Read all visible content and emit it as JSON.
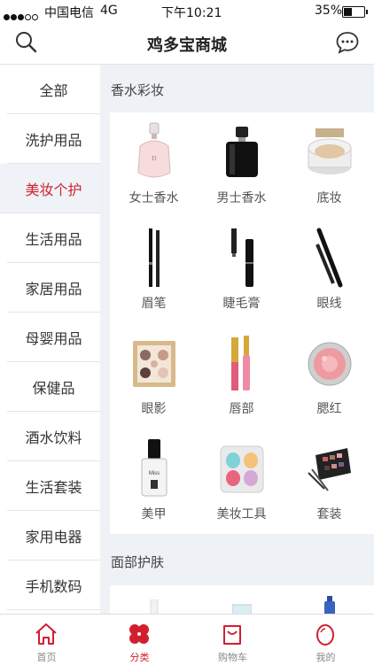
{
  "status_bar": {
    "carrier": "中国电信",
    "network": "4G",
    "time": "下午10:21",
    "battery": "35%"
  },
  "header": {
    "title": "鸡多宝商城",
    "search_icon": "search-icon",
    "chat_icon": "chat-icon"
  },
  "sidebar": {
    "items": [
      {
        "label": "全部"
      },
      {
        "label": "洗护用品"
      },
      {
        "label": "美妆个护",
        "active": true
      },
      {
        "label": "生活用品"
      },
      {
        "label": "家居用品"
      },
      {
        "label": "母婴用品"
      },
      {
        "label": "保健品"
      },
      {
        "label": "酒水饮料"
      },
      {
        "label": "生活套装"
      },
      {
        "label": "家用电器"
      },
      {
        "label": "手机数码"
      }
    ]
  },
  "sections": [
    {
      "title": "香水彩妆",
      "items": [
        {
          "label": "女士香水",
          "icon": "perfume-bottle-icon"
        },
        {
          "label": "男士香水",
          "icon": "cologne-bottle-icon"
        },
        {
          "label": "底妆",
          "icon": "cushion-compact-icon"
        },
        {
          "label": "眉笔",
          "icon": "eyebrow-pencil-icon"
        },
        {
          "label": "睫毛膏",
          "icon": "mascara-icon"
        },
        {
          "label": "眼线",
          "icon": "eyeliner-icon"
        },
        {
          "label": "眼影",
          "icon": "eyeshadow-palette-icon"
        },
        {
          "label": "唇部",
          "icon": "lip-gloss-icon"
        },
        {
          "label": "腮红",
          "icon": "blush-compact-icon"
        },
        {
          "label": "美甲",
          "icon": "nail-polish-icon"
        },
        {
          "label": "美妆工具",
          "icon": "makeup-sponge-icon"
        },
        {
          "label": "套装",
          "icon": "makeup-kit-icon"
        }
      ]
    },
    {
      "title": "面部护肤",
      "items": []
    }
  ],
  "tabbar": [
    {
      "label": "首页",
      "icon": "home-icon"
    },
    {
      "label": "分类",
      "icon": "category-icon",
      "active": true
    },
    {
      "label": "购物车",
      "icon": "cart-icon"
    },
    {
      "label": "我的",
      "icon": "profile-icon"
    }
  ],
  "colors": {
    "accent": "#d0202f",
    "sidebar_active_bg": "#eff3f7",
    "content_bg": "#eef2f6"
  }
}
